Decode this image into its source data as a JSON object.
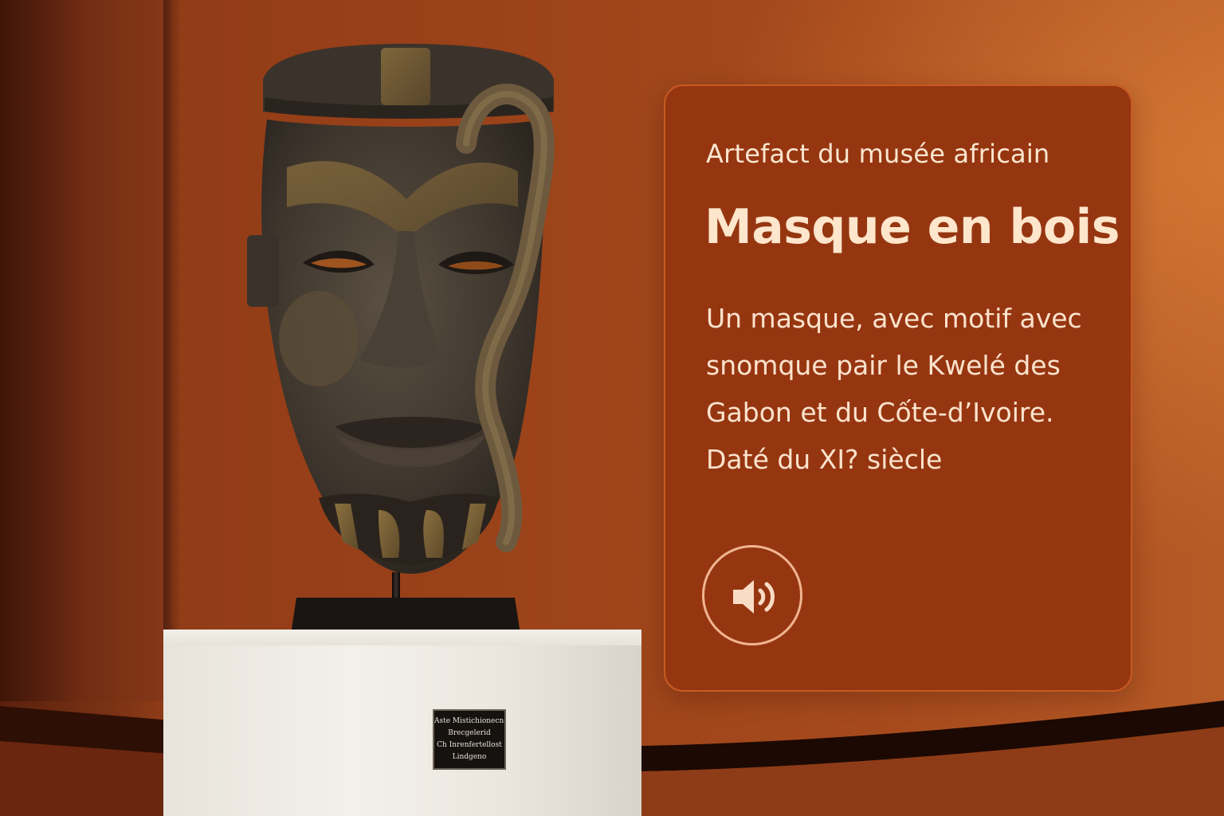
{
  "panel": {
    "kicker": "Artefact du musée africain",
    "title": "Masque en bois",
    "description_lines": [
      "Un masque, avec motif avec",
      "snomque pair le Kwelé des",
      "Gabon et du Cốte-d’Ivoire.",
      "Daté du XI? siècle"
    ],
    "audio_icon": "speaker-icon"
  },
  "plaque": {
    "lines": [
      "Aste Mistichionecnal",
      "Brecgelerid",
      "Ch Inrenfertellost",
      "Lindgeno"
    ]
  },
  "colors": {
    "panel_background": "#963611",
    "panel_border": "#c85a22",
    "text": "#fbe6cf",
    "wall": "#9a4219"
  }
}
